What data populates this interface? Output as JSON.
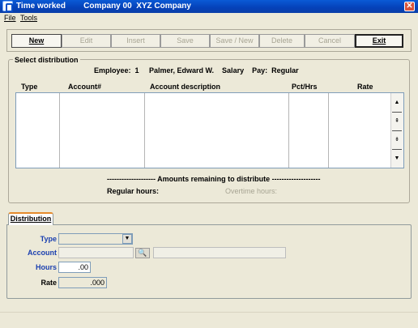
{
  "window": {
    "title": "Time worked        Company 00  XYZ Company",
    "close_glyph": "✕"
  },
  "menu": {
    "file": "File",
    "tools": "Tools"
  },
  "toolbar": {
    "new": "New",
    "edit": "Edit",
    "insert": "Insert",
    "save": "Save",
    "save_new": "Save / New",
    "delete": "Delete",
    "cancel": "Cancel",
    "exit": "Exit"
  },
  "distribution_group": {
    "legend": "Select distribution",
    "employee_line": "Employee:  1     Palmer, Edward W.    Salary    Pay:  Regular",
    "columns": [
      "Type",
      "Account#",
      "Account description",
      "Pct/Hrs",
      "Rate"
    ],
    "scroll_glyphs": [
      "▲",
      "⇞",
      "⇟",
      "▼"
    ],
    "remaining_heading": "-------------------- Amounts remaining to distribute --------------------",
    "regular_hours_label": "Regular hours:",
    "overtime_hours_label": "Overtime hours:"
  },
  "tab": {
    "label": "Distribution"
  },
  "form": {
    "type_label": "Type",
    "type_value": "",
    "account_label": "Account",
    "account_value": "",
    "account_description": "",
    "hours_label": "Hours",
    "hours_value": ".00",
    "rate_label": "Rate",
    "rate_value": ".000",
    "dropdown_glyph": "▼",
    "lookup_glyph": "🔍"
  }
}
